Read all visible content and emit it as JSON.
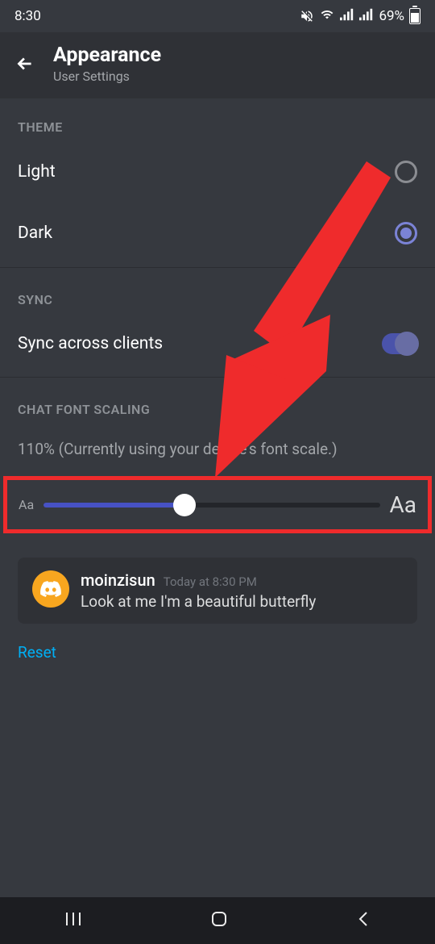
{
  "status": {
    "time": "8:30",
    "battery_pct": "69%"
  },
  "header": {
    "title": "Appearance",
    "subtitle": "User Settings"
  },
  "sections": {
    "theme": {
      "label": "THEME",
      "options": {
        "light": "Light",
        "dark": "Dark"
      },
      "selected": "dark"
    },
    "sync": {
      "label": "SYNC",
      "row_label": "Sync across clients",
      "enabled": true
    },
    "font_scaling": {
      "label": "CHAT FONT SCALING",
      "info": "110% (Currently using your device's font scale.)",
      "small_glyph": "Aa",
      "large_glyph": "Aa",
      "percent": 42
    }
  },
  "preview": {
    "username": "moinzisun",
    "timestamp": "Today at 8:30 PM",
    "message": "Look at me I'm a beautiful butterfly"
  },
  "reset_label": "Reset",
  "annotation": {
    "arrow_color": "#ef2b2c",
    "highlight_color": "#ef2b2c"
  }
}
